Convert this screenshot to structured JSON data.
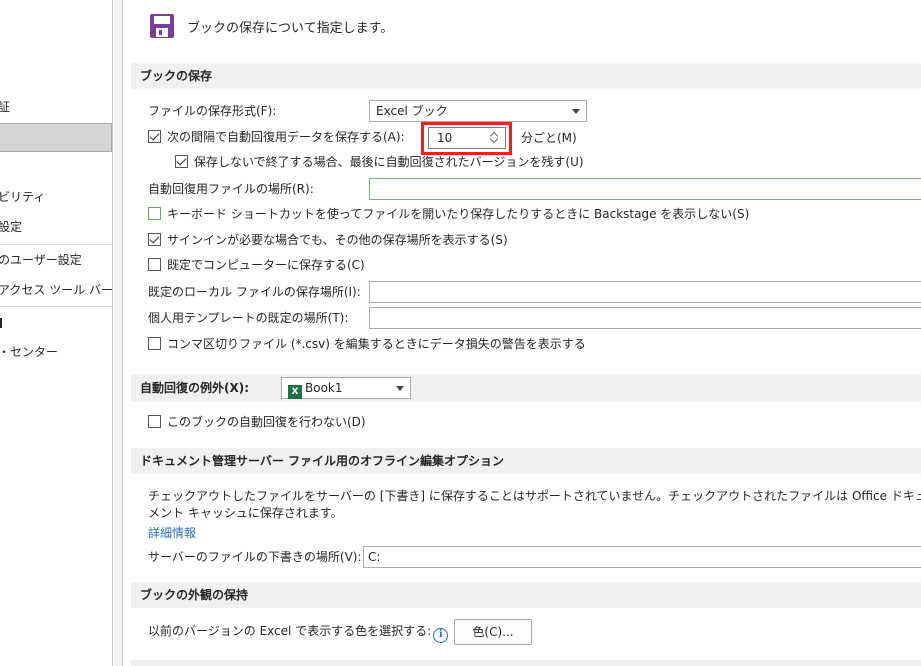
{
  "sidebar": {
    "items": [
      {
        "label": "証"
      },
      {
        "label": ""
      },
      {
        "label": "ビリティ"
      },
      {
        "label": "設定"
      },
      {
        "label": "のユーザー設定"
      },
      {
        "label": " アクセス ツール バー"
      },
      {
        "label": ""
      },
      {
        "label": "・センター"
      }
    ]
  },
  "header": {
    "icon": "save-icon",
    "title": "ブックの保存について指定します。"
  },
  "save_section": {
    "title": "ブックの保存",
    "format_label": "ファイルの保存形式(F):",
    "format_value": "Excel ブック",
    "autorecover_label": "次の間隔で自動回復用データを保存する(A):",
    "autorecover_checked": true,
    "interval_value": "10",
    "interval_unit": "分ごと(M)",
    "keep_last_label": "保存しないで終了する場合、最後に自動回復されたバージョンを残す(U)",
    "keep_last_checked": true,
    "autorecover_location_label": "自動回復用ファイルの場所(R):",
    "autorecover_location_value": "",
    "backstage_label": "キーボード ショートカットを使ってファイルを開いたり保存したりするときに Backstage を表示しない(S)",
    "backstage_checked": false,
    "signin_label": "サインインが必要な場合でも、その他の保存場所を表示する(S)",
    "signin_checked": true,
    "default_computer_label": "既定でコンピューターに保存する(C)",
    "default_computer_checked": false,
    "local_location_label": "既定のローカル ファイルの保存場所(I):",
    "local_location_value": "",
    "template_location_label": "個人用テンプレートの既定の場所(T):",
    "template_location_value": "",
    "csv_warning_label": "コンマ区切りファイル (*.csv) を編集するときにデータ損失の警告を表示する",
    "csv_warning_checked": false
  },
  "exceptions_section": {
    "title": "自動回復の例外(X):",
    "workbook_value": "Book1",
    "disable_label": "このブックの自動回復を行わない(D)",
    "disable_checked": false
  },
  "offline_section": {
    "title": "ドキュメント管理サーバー ファイル用のオフライン編集オプション",
    "description": "チェックアウトしたファイルをサーバーの [下書き] に保存することはサポートされていません。チェックアウトされたファイルは Office ドキュメント キャッシュに保存されます。",
    "more_info_link": "詳細情報",
    "drafts_location_label": "サーバーのファイルの下書きの場所(V):",
    "drafts_location_value": "C:"
  },
  "appearance_section": {
    "title": "ブックの外観の保持",
    "colors_label": "以前のバージョンの Excel で表示する色を選択する:",
    "colors_button": "色(C)..."
  },
  "colors": {
    "highlight": "#e8251b",
    "link": "#2e6db4",
    "section_bg": "#f0f0f0",
    "save_icon": "#7b3f98"
  }
}
